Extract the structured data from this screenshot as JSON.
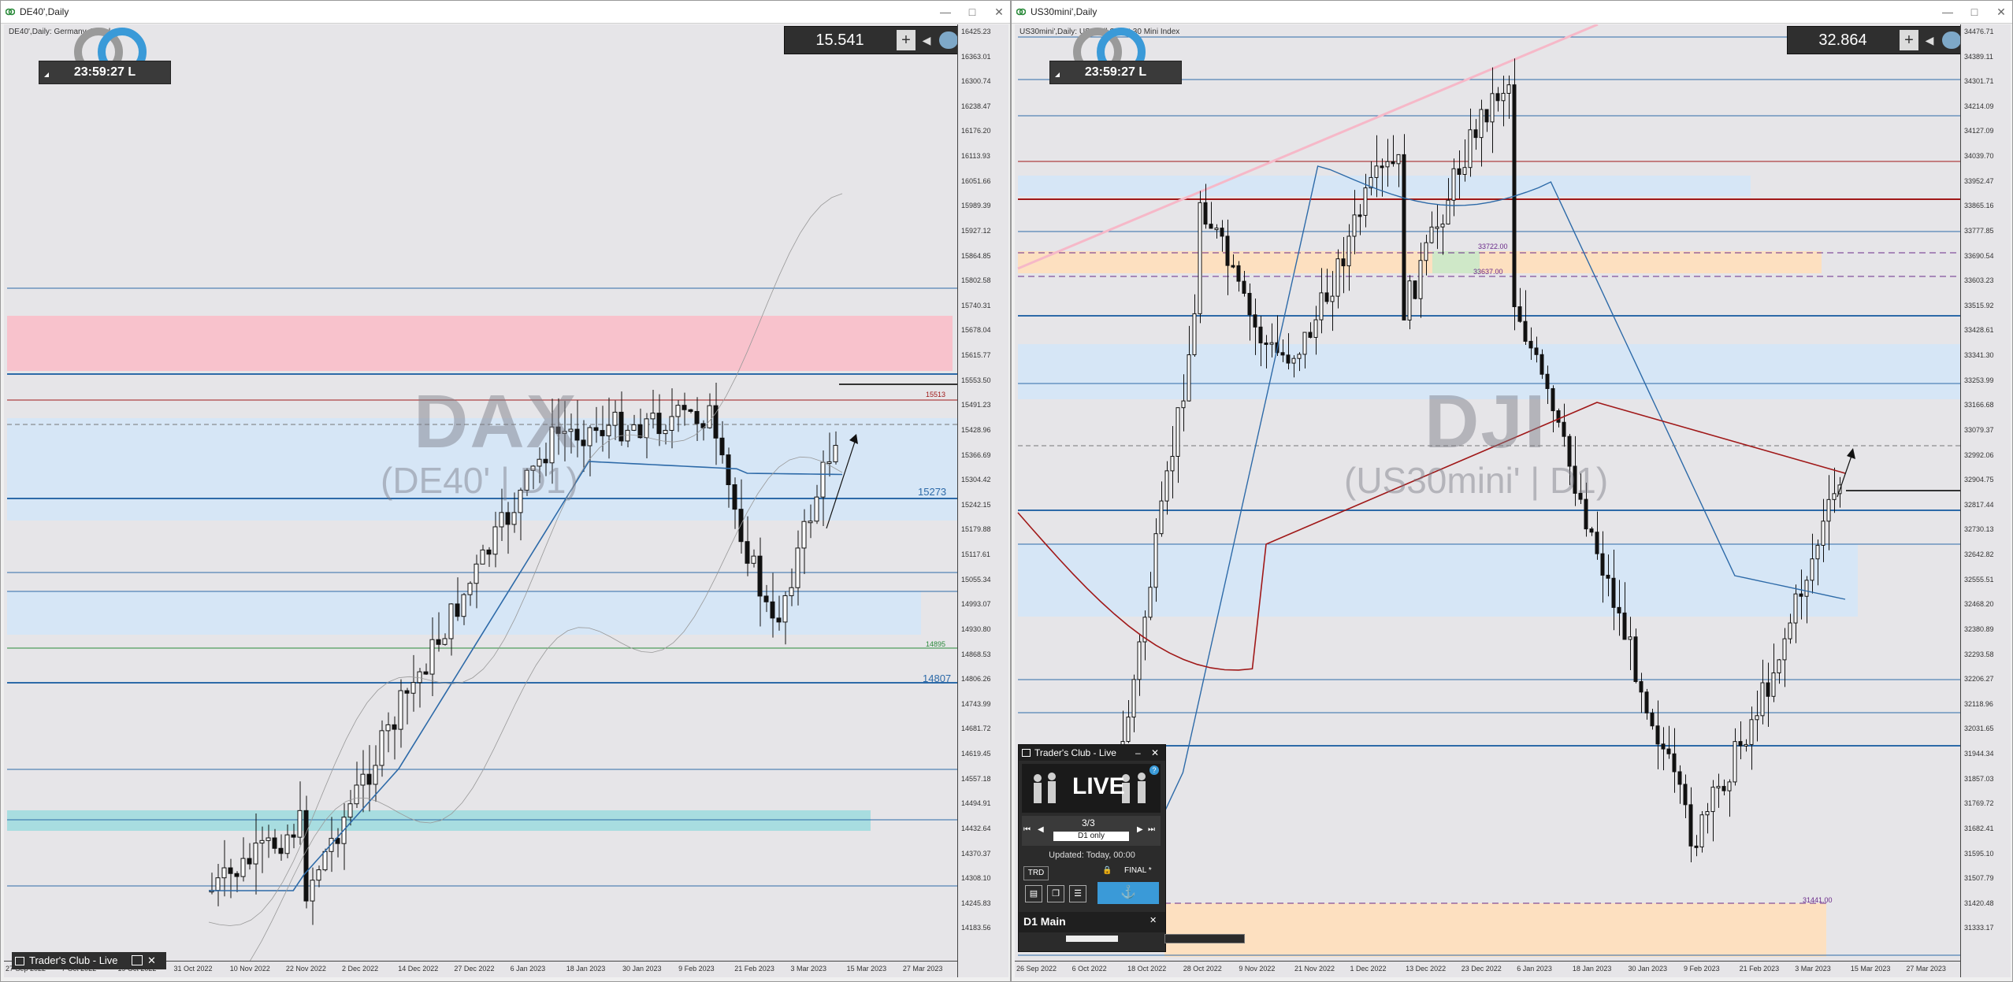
{
  "left_window": {
    "title": "DE40',Daily",
    "description": "DE40',Daily:  Germany 40 Index",
    "clock": "23:59:27 L",
    "spread_value": "15.541",
    "watermark_symbol": "DAX",
    "watermark_sub": "(DE40' | D1)",
    "price_ticks": [
      "16425.23",
      "16363.01",
      "16300.74",
      "16238.47",
      "16176.20",
      "16113.93",
      "16051.66",
      "15989.39",
      "15927.12",
      "15864.85",
      "15802.58",
      "15740.31",
      "15678.04",
      "15615.77",
      "15553.50",
      "15491.23",
      "15428.96",
      "15366.69",
      "15304.42",
      "15242.15",
      "15179.88",
      "15117.61",
      "15055.34",
      "14993.07",
      "14930.80",
      "14868.53",
      "14806.26",
      "14743.99",
      "14681.72",
      "14619.45",
      "14557.18",
      "14494.91",
      "14432.64",
      "14370.37",
      "14308.10",
      "14245.83",
      "14183.56"
    ],
    "dates": [
      "27 Sep 2022",
      "7 Oct 2022",
      "19 Oct 2022",
      "31 Oct 2022",
      "10 Nov 2022",
      "22 Nov 2022",
      "2 Dec 2022",
      "14 Dec 2022",
      "27 Dec 2022",
      "6 Jan 2023",
      "18 Jan 2023",
      "30 Jan 2023",
      "9 Feb 2023",
      "21 Feb 2023",
      "3 Mar 2023",
      "15 Mar 2023",
      "27 Mar 2023"
    ],
    "level_labels": {
      "l15513": "15513",
      "l15273": "15273",
      "l14895": "14895",
      "l14807": "14807"
    },
    "mini_panel_label": "Trader's Club - Live"
  },
  "right_window": {
    "title": "US30mini',Daily",
    "description": "US30mini',Daily:  US Wall Street 30 Mini Index",
    "clock": "23:59:27 L",
    "spread_value": "32.864",
    "watermark_symbol": "DJI",
    "watermark_sub": "(US30mini' | D1)",
    "price_ticks": [
      "34476.71",
      "34389.11",
      "34301.71",
      "34214.09",
      "34127.09",
      "34039.70",
      "33952.47",
      "33865.16",
      "33777.85",
      "33690.54",
      "33603.23",
      "33515.92",
      "33428.61",
      "33341.30",
      "33253.99",
      "33166.68",
      "33079.37",
      "32992.06",
      "32904.75",
      "32817.44",
      "32730.13",
      "32642.82",
      "32555.51",
      "32468.20",
      "32380.89",
      "32293.58",
      "32206.27",
      "32118.96",
      "32031.65",
      "31944.34",
      "31857.03",
      "31769.72",
      "31682.41",
      "31595.10",
      "31507.79",
      "31420.48",
      "31333.17"
    ],
    "dates": [
      "26 Sep 2022",
      "6 Oct 2022",
      "18 Oct 2022",
      "28 Oct 2022",
      "9 Nov 2022",
      "21 Nov 2022",
      "1 Dec 2022",
      "13 Dec 2022",
      "23 Dec 2022",
      "6 Jan 2023",
      "18 Jan 2023",
      "30 Jan 2023",
      "9 Feb 2023",
      "21 Feb 2023",
      "3 Mar 2023",
      "15 Mar 2023",
      "27 Mar 2023"
    ],
    "level_labels": {
      "l33722": "33722.00",
      "l33637": "33637.00",
      "l31441": "31441.00"
    },
    "traders_club": {
      "title": "Trader's Club - Live",
      "live_text": "LIVE",
      "counter": "3/3",
      "filter": "D1 only",
      "updated": "Updated: Today, 00:00",
      "trd": "TRD",
      "final": "FINAL *",
      "d1_main": "D1 Main"
    }
  },
  "colors": {
    "blue_line": "#2d6aa8",
    "red_line": "#a01818",
    "pink_zone": "#f8c2cc",
    "blue_zone": "#d6e6f6",
    "orange_zone": "#fde0c0",
    "cyan_zone": "#a8dde0"
  }
}
